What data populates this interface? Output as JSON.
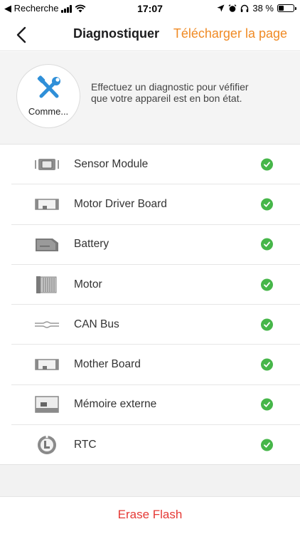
{
  "status_bar": {
    "back_app": "◀ Recherche",
    "time": "17:07",
    "battery_percent": "38 %",
    "battery_level": 0.38
  },
  "nav": {
    "title": "Diagnostiquer",
    "action": "Télécharger la page"
  },
  "intro": {
    "start_label": "Comme...",
    "description": "Effectuez un diagnostic pour véfifier que votre appareil est en bon état."
  },
  "components": [
    {
      "label": "Sensor Module",
      "icon": "sensor-module-icon",
      "status": "ok"
    },
    {
      "label": "Motor Driver Board",
      "icon": "motor-driver-board-icon",
      "status": "ok"
    },
    {
      "label": "Battery",
      "icon": "battery-icon",
      "status": "ok"
    },
    {
      "label": "Motor",
      "icon": "motor-icon",
      "status": "ok"
    },
    {
      "label": "CAN Bus",
      "icon": "can-bus-icon",
      "status": "ok"
    },
    {
      "label": "Mother Board",
      "icon": "mother-board-icon",
      "status": "ok"
    },
    {
      "label": "Mémoire externe",
      "icon": "external-memory-icon",
      "status": "ok"
    },
    {
      "label": "RTC",
      "icon": "rtc-icon",
      "status": "ok"
    }
  ],
  "footer": {
    "erase_label": "Erase Flash"
  },
  "colors": {
    "accent": "#f08a24",
    "ok": "#46b649",
    "danger": "#e53935",
    "tool_icon": "#2f8fd8"
  }
}
